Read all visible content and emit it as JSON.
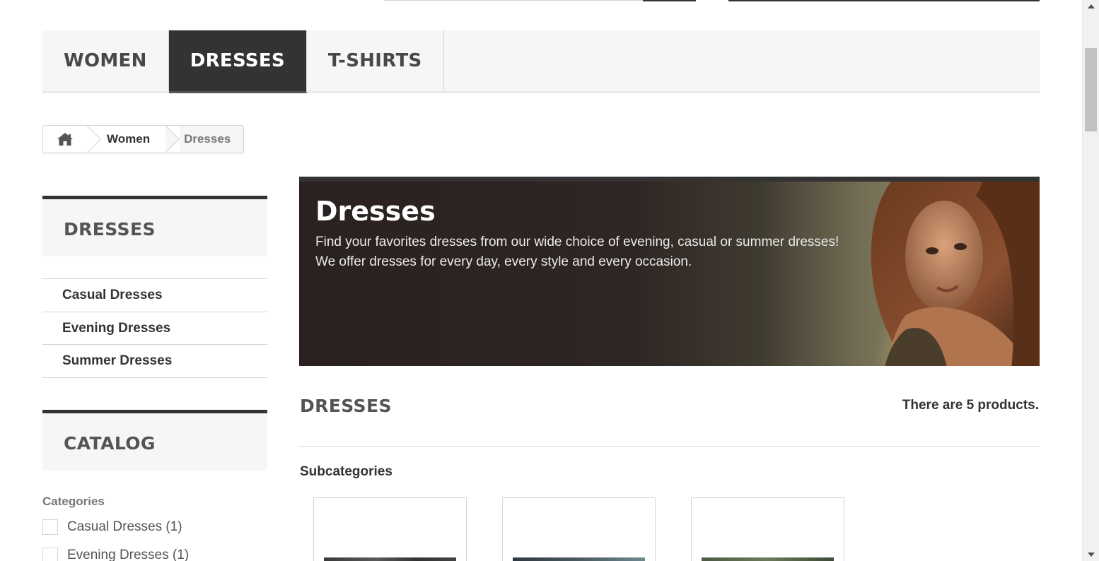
{
  "menu": {
    "items": [
      {
        "label": "WOMEN",
        "active": false
      },
      {
        "label": "DRESSES",
        "active": true
      },
      {
        "label": "T-SHIRTS",
        "active": false
      }
    ]
  },
  "breadcrumb": {
    "home_icon": "home-icon",
    "items": [
      "Women",
      "Dresses"
    ]
  },
  "left": {
    "dresses_block": {
      "title": "DRESSES",
      "items": [
        "Casual Dresses",
        "Evening Dresses",
        "Summer Dresses"
      ]
    },
    "catalog_block": {
      "title": "CATALOG",
      "filter_heading": "Categories",
      "filters": [
        "Casual Dresses (1)",
        "Evening Dresses (1)"
      ]
    }
  },
  "banner": {
    "title": "Dresses",
    "line1": "Find your favorites dresses from our wide choice of evening, casual or summer dresses!",
    "line2": "We offer dresses for every day, every style and every occasion."
  },
  "category": {
    "heading": "DRESSES",
    "count_text": "There are 5 products.",
    "subcategories_title": "Subcategories"
  },
  "colors": {
    "accent_dark": "#333333",
    "panel_bg": "#f6f6f6",
    "border": "#d6d4d4"
  }
}
